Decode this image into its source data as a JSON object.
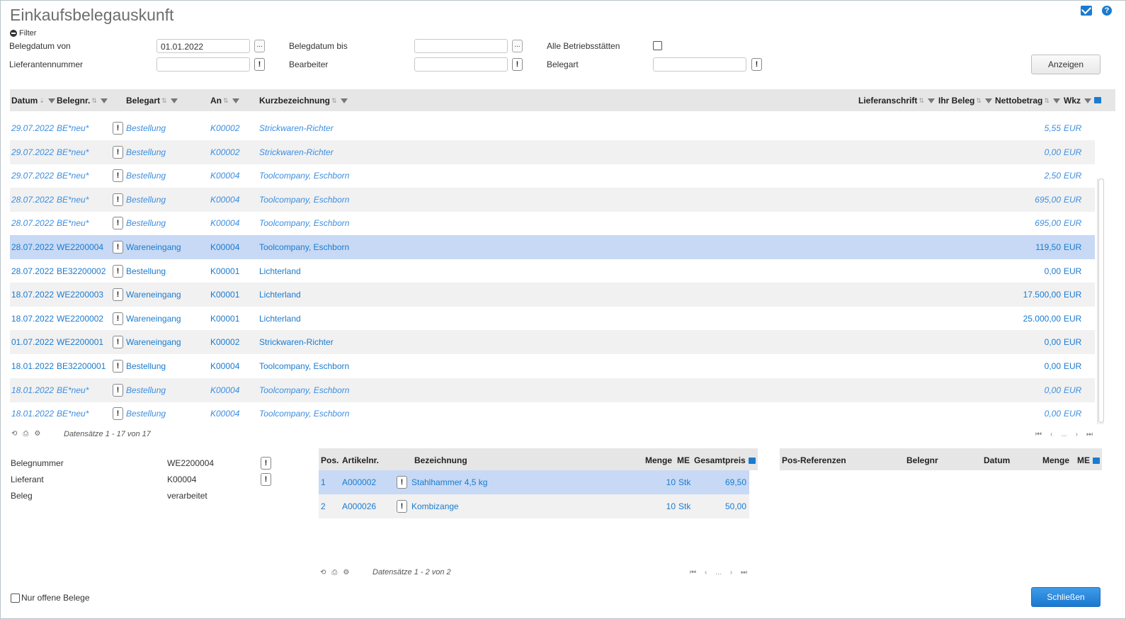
{
  "title": "Einkaufsbelegauskunft",
  "filter": {
    "toggle_label": "Filter",
    "belegdatum_von_label": "Belegdatum von",
    "belegdatum_von_value": "01.01.2022",
    "belegdatum_bis_label": "Belegdatum bis",
    "belegdatum_bis_value": "",
    "alle_betriebsstaetten_label": "Alle Betriebsstätten",
    "lieferantennummer_label": "Lieferantennummer",
    "lieferantennummer_value": "",
    "bearbeiter_label": "Bearbeiter",
    "bearbeiter_value": "",
    "belegart_label": "Belegart",
    "belegart_value": "",
    "anzeigen_label": "Anzeigen",
    "ellipsis": "...",
    "info_glyph": "!"
  },
  "grid": {
    "headers": {
      "datum": "Datum",
      "belegnr": "Belegnr.",
      "belegart": "Belegart",
      "an": "An",
      "kurzbezeichnung": "Kurzbezeichnung",
      "lieferanschrift": "Lieferanschrift",
      "ihr_beleg": "Ihr Beleg",
      "nettobetrag": "Nettobetrag",
      "wkz": "Wkz"
    },
    "rows": [
      {
        "datum": "29.07.2022",
        "belegnr": "BE*neu*",
        "belegart": "Bestellung",
        "an": "K00002",
        "kurz": "Strickwaren-Richter",
        "netto": "5,55",
        "wkz": "EUR"
      },
      {
        "datum": "29.07.2022",
        "belegnr": "BE*neu*",
        "belegart": "Bestellung",
        "an": "K00002",
        "kurz": "Strickwaren-Richter",
        "netto": "0,00",
        "wkz": "EUR"
      },
      {
        "datum": "29.07.2022",
        "belegnr": "BE*neu*",
        "belegart": "Bestellung",
        "an": "K00004",
        "kurz": "Toolcompany, Eschborn",
        "netto": "2,50",
        "wkz": "EUR"
      },
      {
        "datum": "28.07.2022",
        "belegnr": "BE*neu*",
        "belegart": "Bestellung",
        "an": "K00004",
        "kurz": "Toolcompany, Eschborn",
        "netto": "695,00",
        "wkz": "EUR"
      },
      {
        "datum": "28.07.2022",
        "belegnr": "BE*neu*",
        "belegart": "Bestellung",
        "an": "K00004",
        "kurz": "Toolcompany, Eschborn",
        "netto": "695,00",
        "wkz": "EUR"
      },
      {
        "datum": "28.07.2022",
        "belegnr": "WE2200004",
        "belegart": "Wareneingang",
        "an": "K00004",
        "kurz": "Toolcompany, Eschborn",
        "netto": "119,50",
        "wkz": "EUR"
      },
      {
        "datum": "28.07.2022",
        "belegnr": "BE32200002",
        "belegart": "Bestellung",
        "an": "K00001",
        "kurz": "Lichterland",
        "netto": "0,00",
        "wkz": "EUR"
      },
      {
        "datum": "18.07.2022",
        "belegnr": "WE2200003",
        "belegart": "Wareneingang",
        "an": "K00001",
        "kurz": "Lichterland",
        "netto": "17.500,00",
        "wkz": "EUR"
      },
      {
        "datum": "18.07.2022",
        "belegnr": "WE2200002",
        "belegart": "Wareneingang",
        "an": "K00001",
        "kurz": "Lichterland",
        "netto": "25.000,00",
        "wkz": "EUR"
      },
      {
        "datum": "01.07.2022",
        "belegnr": "WE2200001",
        "belegart": "Wareneingang",
        "an": "K00002",
        "kurz": "Strickwaren-Richter",
        "netto": "0,00",
        "wkz": "EUR"
      },
      {
        "datum": "18.01.2022",
        "belegnr": "BE32200001",
        "belegart": "Bestellung",
        "an": "K00004",
        "kurz": "Toolcompany, Eschborn",
        "netto": "0,00",
        "wkz": "EUR"
      },
      {
        "datum": "18.01.2022",
        "belegnr": "BE*neu*",
        "belegart": "Bestellung",
        "an": "K00004",
        "kurz": "Toolcompany, Eschborn",
        "netto": "0,00",
        "wkz": "EUR"
      },
      {
        "datum": "18.01.2022",
        "belegnr": "BE*neu*",
        "belegart": "Bestellung",
        "an": "K00004",
        "kurz": "Toolcompany, Eschborn",
        "netto": "0,00",
        "wkz": "EUR"
      }
    ],
    "footer": "Datensätze 1 - 17 von 17",
    "pager_ellipsis": "..."
  },
  "details": {
    "belegnummer_label": "Belegnummer",
    "belegnummer_value": "WE2200004",
    "lieferant_label": "Lieferant",
    "lieferant_value": "K00004",
    "beleg_label": "Beleg",
    "beleg_value": "verarbeitet"
  },
  "positions": {
    "headers": {
      "pos": "Pos.",
      "artikelnr": "Artikelnr.",
      "bezeichnung": "Bezeichnung",
      "menge": "Menge",
      "me": "ME",
      "gesamtpreis": "Gesamtpreis"
    },
    "rows": [
      {
        "pos": "1",
        "artikelnr": "A000002",
        "bezeichnung": "Stahlhammer 4,5 kg",
        "menge": "10",
        "me": "Stk",
        "gesamtpreis": "69,50"
      },
      {
        "pos": "2",
        "artikelnr": "A000026",
        "bezeichnung": "Kombizange",
        "menge": "10",
        "me": "Stk",
        "gesamtpreis": "50,00"
      }
    ],
    "footer": "Datensätze 1 - 2 von 2",
    "pager_ellipsis": "..."
  },
  "references": {
    "headers": {
      "pos_referenzen": "Pos-Referenzen",
      "belegnr": "Belegnr",
      "datum": "Datum",
      "menge": "Menge",
      "me": "ME"
    }
  },
  "bottom": {
    "nur_offene_label": "Nur offene Belege",
    "schliessen_label": "Schließen"
  }
}
